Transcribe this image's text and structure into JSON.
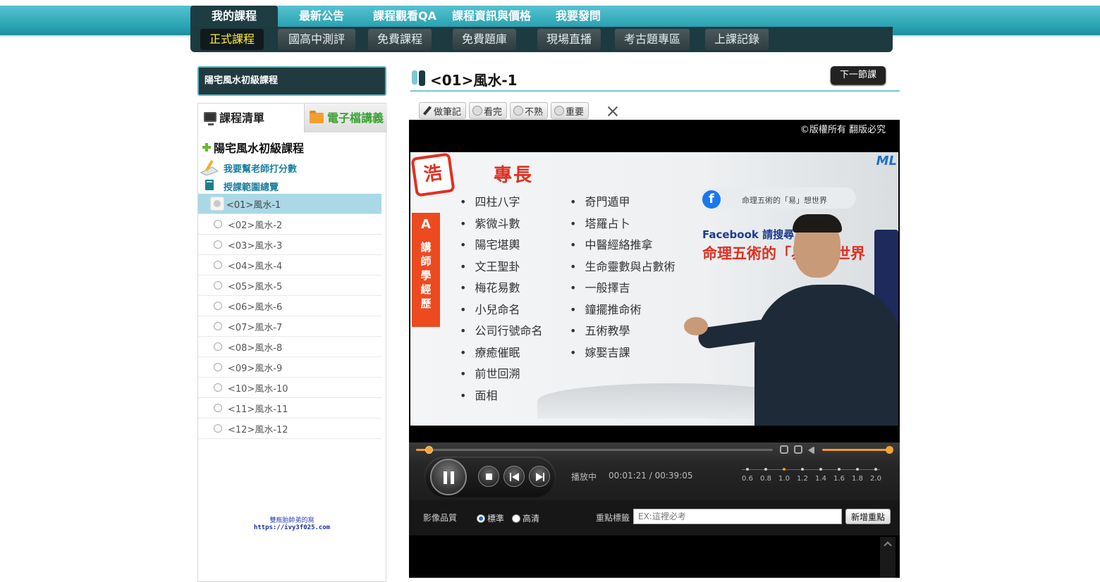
{
  "nav": {
    "main": [
      "我的課程",
      "最新公告",
      "課程觀看QA",
      "課程資訊與價格",
      "我要發問"
    ],
    "sub": [
      "正式課程",
      "國高中測評",
      "免費課程",
      "免費題庫",
      "現場直播",
      "考古題專區",
      "上課記錄"
    ]
  },
  "sidebar": {
    "course_name": "陽宅風水初級課程",
    "tabs": {
      "list": "課程清單",
      "ebook": "電子檔講義"
    },
    "tree_root": "陽宅風水初級課程",
    "rate_teacher": "我要幫老師打分數",
    "syllabus": "授課範圍總覽",
    "lessons": [
      "<01>風水-1",
      "<02>風水-2",
      "<03>風水-3",
      "<04>風水-4",
      "<05>風水-5",
      "<06>風水-6",
      "<07>風水-7",
      "<08>風水-8",
      "<09>風水-9",
      "<10>風水-10",
      "<11>風水-11",
      "<12>風水-12"
    ],
    "footer_line1": "雙瓶胎帥弟的窩",
    "footer_line2": "https://ivy3f025.com"
  },
  "main": {
    "lesson_title": "<01>風水-1",
    "next_lesson": "下一節課",
    "toolbar": {
      "note": "做筆記",
      "watched": "看完",
      "unfamiliar": "不熟",
      "important": "重要"
    }
  },
  "player": {
    "copyright": "©版權所有 翻版必究",
    "video": {
      "seal": "浩",
      "heading": "專長",
      "side_letter": "A",
      "side_text": "講師學經歷",
      "col1": [
        "四柱八字",
        "紫微斗數",
        "陽宅堪輿",
        "文王聖卦",
        "梅花易數",
        "小兒命名",
        "公司行號命名",
        "療癒催眠",
        "前世回溯",
        "面相"
      ],
      "col2": [
        "奇門遁甲",
        "塔羅占卜",
        "中醫經絡推拿",
        "生命靈數與占數術",
        "一般擇吉",
        "鐘擺推命術",
        "五術教學",
        "嫁娶吉課"
      ],
      "fb_search": "命理五術的「易」想世界",
      "fb_label": "Facebook 請搜尋：",
      "big_text": "命理五術的「易」想世界",
      "logo": "ML"
    },
    "seek_fraction": 0.035,
    "status": "播放中",
    "timecode": "00:01:21 / 00:39:05",
    "speeds": [
      "0.6",
      "0.8",
      "1.0",
      "1.2",
      "1.4",
      "1.6",
      "1.8",
      "2.0"
    ],
    "current_speed": "1.0",
    "quality_label": "影像品質",
    "quality_options": [
      "標準",
      "高清"
    ],
    "quality_selected": "標準",
    "mark_label": "重點標籤",
    "mark_placeholder": "EX:這裡必考",
    "add_mark": "新增重點"
  },
  "colors": {
    "teal": "#2aa3b3",
    "dark_nav": "#1d3a40",
    "active_sub_text": "#ffef3a",
    "accent_orange": "#f29b2b"
  }
}
